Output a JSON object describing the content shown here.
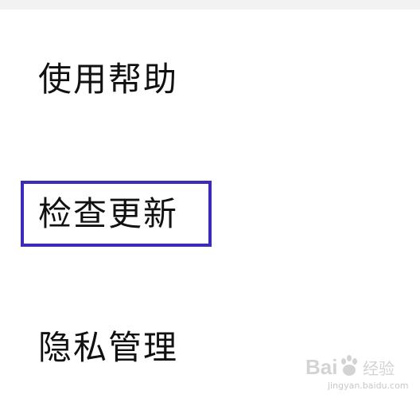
{
  "menu": {
    "items": [
      {
        "label": "使用帮助"
      },
      {
        "label": "检查更新"
      },
      {
        "label": "隐私管理"
      }
    ],
    "highlighted_index": 1,
    "highlight_color": "#3b2bb8"
  },
  "watermark": {
    "brand": "Baidu经验",
    "url": "jingyan.baidu.com"
  }
}
